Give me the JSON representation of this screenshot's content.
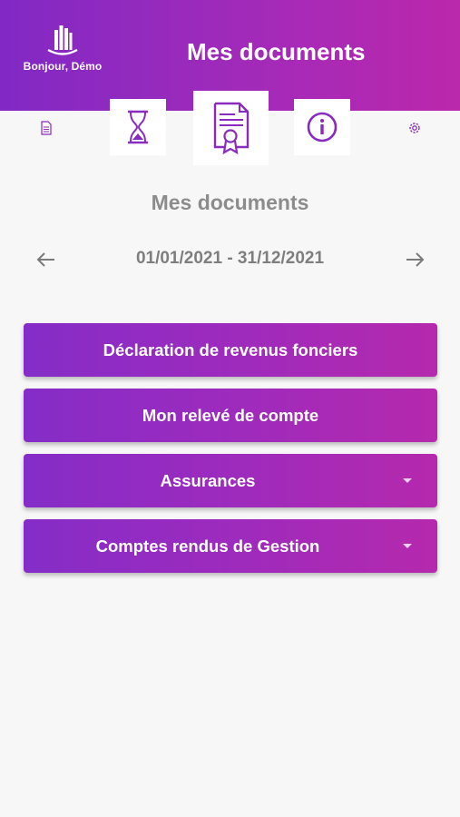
{
  "header": {
    "greeting": "Bonjour, Démo",
    "title": "Mes documents",
    "brand_colors": [
      "#8129c4",
      "#bb28ab"
    ]
  },
  "tabs": [
    {
      "icon": "document-icon",
      "size": "small"
    },
    {
      "icon": "hourglass-icon",
      "size": "mid"
    },
    {
      "icon": "certificate-icon",
      "size": "big",
      "active": true
    },
    {
      "icon": "info-icon",
      "size": "mid"
    },
    {
      "icon": "gear-icon",
      "size": "small"
    }
  ],
  "main": {
    "heading": "Mes documents",
    "period": "01/01/2021 - 31/12/2021",
    "buttons": [
      {
        "label": "Déclaration de revenus fonciers",
        "dropdown": false
      },
      {
        "label": "Mon relevé de compte",
        "dropdown": false
      },
      {
        "label": "Assurances",
        "dropdown": true
      },
      {
        "label": "Comptes rendus de Gestion",
        "dropdown": true
      }
    ]
  },
  "colors": {
    "accent": "#9a2bbf",
    "icon_purple": "#8a2bbf",
    "heading_gray": "#8c8c8c",
    "background": "#f7f7f7"
  }
}
